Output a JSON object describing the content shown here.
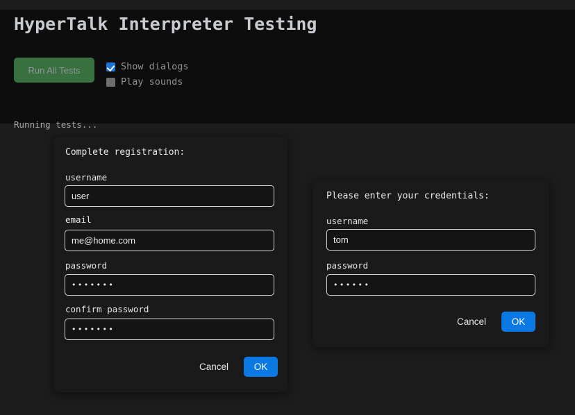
{
  "app": {
    "title": "HyperTalk Interpreter Testing",
    "status": "Running tests...",
    "colors": {
      "page_background": "#1c1c1c",
      "panel_background": "#0d0d0d",
      "dialog_background": "#1a1a1a",
      "run_button": "#39703f",
      "primary_accent": "#0b79e3",
      "checkbox_checked": "#1a73d6",
      "checkbox_unchecked": "#6b6f72"
    }
  },
  "toolbar": {
    "run_all_label": "Run All Tests",
    "options": [
      {
        "label": "Show dialogs",
        "checked": true,
        "icon": "checkbox-checked-icon"
      },
      {
        "label": "Play sounds",
        "checked": false,
        "icon": "checkbox-unchecked-icon"
      }
    ]
  },
  "dialogs": [
    {
      "id": "register",
      "prompt": "Complete registration:",
      "fields": [
        {
          "label": "username",
          "value": "user",
          "type": "text",
          "placeholder": ""
        },
        {
          "label": "email",
          "value": "me@home.com",
          "type": "text",
          "placeholder": ""
        },
        {
          "label": "password",
          "value": "•••••••",
          "type": "password",
          "placeholder": ""
        },
        {
          "label": "confirm password",
          "value": "•••••••",
          "type": "password",
          "placeholder": ""
        }
      ],
      "cancel_label": "Cancel",
      "ok_label": "OK"
    },
    {
      "id": "credentials",
      "prompt": "Please enter your credentials:",
      "fields": [
        {
          "label": "username",
          "value": "tom",
          "type": "text",
          "placeholder": ""
        },
        {
          "label": "password",
          "value": "••••••",
          "type": "password",
          "placeholder": ""
        }
      ],
      "cancel_label": "Cancel",
      "ok_label": "OK"
    }
  ]
}
